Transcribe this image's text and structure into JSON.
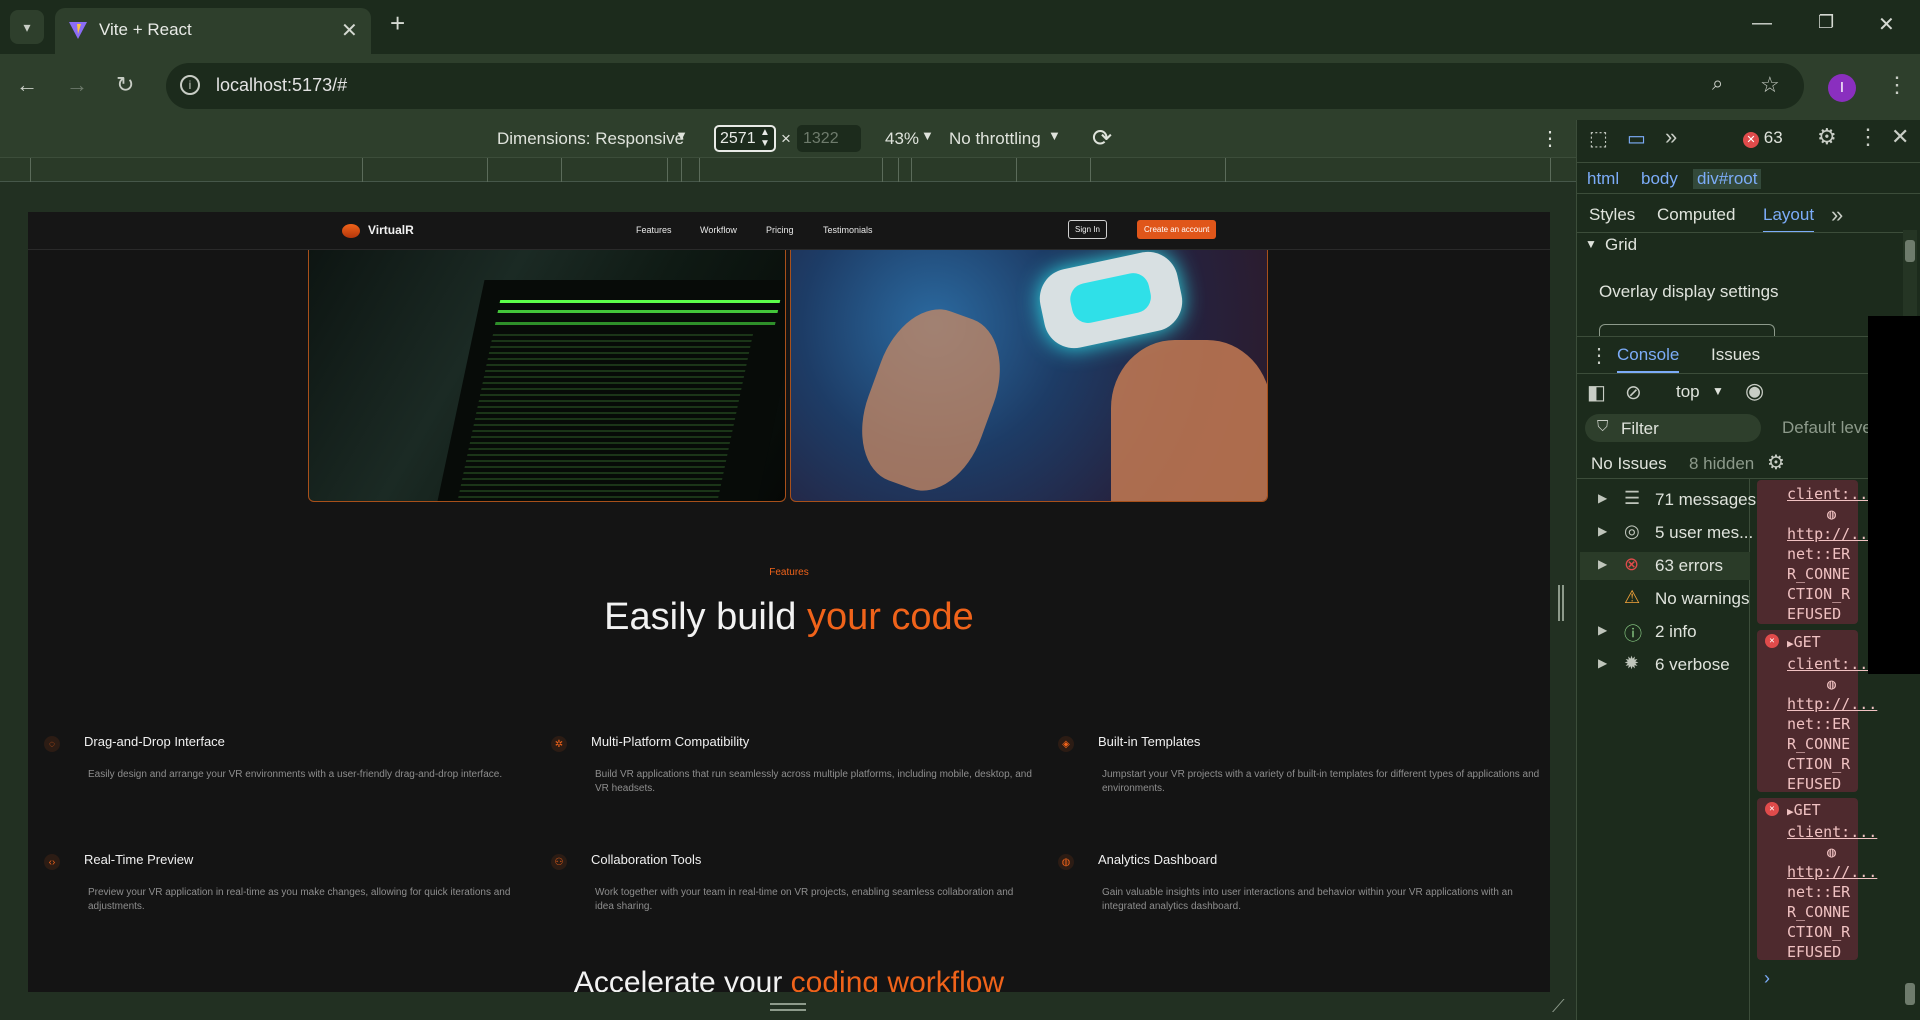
{
  "browser": {
    "tab_title": "Vite + React",
    "url": "localhost:5173/#",
    "profile_initial": "I",
    "new_tab_symbol": "+"
  },
  "device_toolbar": {
    "dimensions_label": "Dimensions: Responsive",
    "width": "2571",
    "height_placeholder": "1322",
    "times": "×",
    "zoom": "43%",
    "throttling": "No throttling"
  },
  "site": {
    "brand": "VirtualR",
    "nav": [
      "Features",
      "Workflow",
      "Pricing",
      "Testimonials"
    ],
    "sign_in": "Sign In",
    "create_account": "Create an account",
    "features_eyebrow": "Features",
    "features_title_plain": "Easily build ",
    "features_title_accent": "your code",
    "features": [
      {
        "title": "Drag-and-Drop Interface",
        "desc": "Easily design and arrange your VR environments with a user-friendly drag-and-drop interface."
      },
      {
        "title": "Multi-Platform Compatibility",
        "desc": "Build VR applications that run seamlessly across multiple platforms, including mobile, desktop, and VR headsets."
      },
      {
        "title": "Built-in Templates",
        "desc": "Jumpstart your VR projects with a variety of built-in templates for different types of applications and environments."
      },
      {
        "title": "Real-Time Preview",
        "desc": "Preview your VR application in real-time as you make changes, allowing for quick iterations and adjustments."
      },
      {
        "title": "Collaboration Tools",
        "desc": "Work together with your team in real-time on VR projects, enabling seamless collaboration and idea sharing."
      },
      {
        "title": "Analytics Dashboard",
        "desc": "Gain valuable insights into user interactions and behavior within your VR applications with an integrated analytics dashboard."
      }
    ],
    "workflow_title_plain": "Accelerate your ",
    "workflow_title_accent": "coding workflow"
  },
  "devtools": {
    "error_count": "63",
    "breadcrumbs": [
      "html",
      "body",
      "div#root"
    ],
    "panel_tabs": [
      "Styles",
      "Computed",
      "Layout"
    ],
    "grid_section": "Grid",
    "overlay_settings": "Overlay display settings",
    "drawer_tabs": [
      "Console",
      "Issues"
    ],
    "context": "top",
    "filter_placeholder": "Filter",
    "default_levels": "Default leve",
    "no_issues": "No Issues",
    "hidden": "8 hidden",
    "sidebar": [
      {
        "label": "71 messages"
      },
      {
        "label": "5 user mes..."
      },
      {
        "label": "63 errors"
      },
      {
        "label": "No warnings"
      },
      {
        "label": "2 info"
      },
      {
        "label": "6 verbose"
      }
    ],
    "messages": [
      {
        "get": "",
        "client": "client:...",
        "http": "http://...",
        "error": "net::ERR_CONNECTION_REFUSED"
      },
      {
        "get": "GET",
        "client": "client:...",
        "http": "http://...",
        "error": "net::ERR_CONNECTION_REFUSED"
      },
      {
        "get": "GET",
        "client": "client:...",
        "http": "http://...",
        "error": "net::ERR_CONNECTION_REFUSED"
      }
    ],
    "prompt": "›"
  },
  "colors": {
    "accent": "#f0631a",
    "chrome_bg": "#2e3f2c",
    "error_bg": "#4e2a2e"
  }
}
